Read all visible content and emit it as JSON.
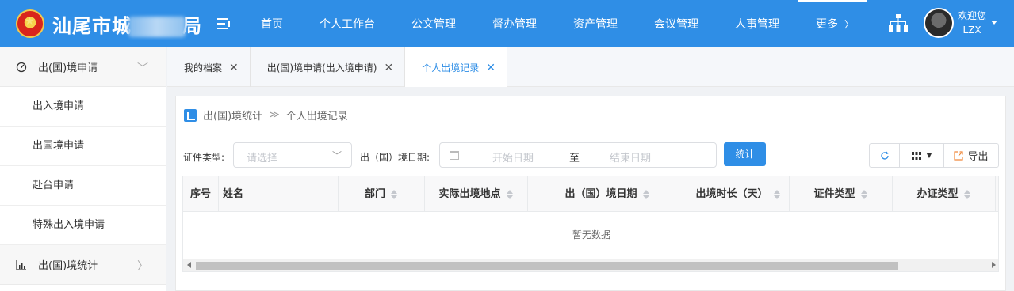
{
  "header": {
    "title_prefix": "汕尾市城",
    "title_suffix": "局",
    "nav": [
      "首页",
      "个人工作台",
      "公文管理",
      "督办管理",
      "资产管理",
      "会议管理",
      "人事管理",
      "更多"
    ],
    "welcome": "欢迎您",
    "user": "LZX",
    "brand_color": "#2f8ee6"
  },
  "sidebar": {
    "group1": "出(国)境申请",
    "items": [
      "出入境申请",
      "出国境申请",
      "赴台申请",
      "特殊出入境申请"
    ],
    "group2": "出(国)境统计"
  },
  "tabs": [
    {
      "label": "我的档案"
    },
    {
      "label": "出(国)境申请(出入境申请)"
    },
    {
      "label": "个人出境记录",
      "active": true
    }
  ],
  "breadcrumb": {
    "parent": "出(国)境统计",
    "sep": "≫",
    "current": "个人出境记录"
  },
  "filters": {
    "cert_type_label": "证件类型:",
    "cert_type_placeholder": "请选择",
    "date_label": "出（国）境日期:",
    "start_placeholder": "开始日期",
    "to": "至",
    "end_placeholder": "结束日期",
    "search_button": "统计"
  },
  "toolbar": {
    "export": "导出"
  },
  "table": {
    "columns": [
      "序号",
      "姓名",
      "部门",
      "实际出境地点",
      "出（国）境日期",
      "出境时长（天）",
      "证件类型",
      "办证类型"
    ],
    "empty_text": "暂无数据"
  }
}
